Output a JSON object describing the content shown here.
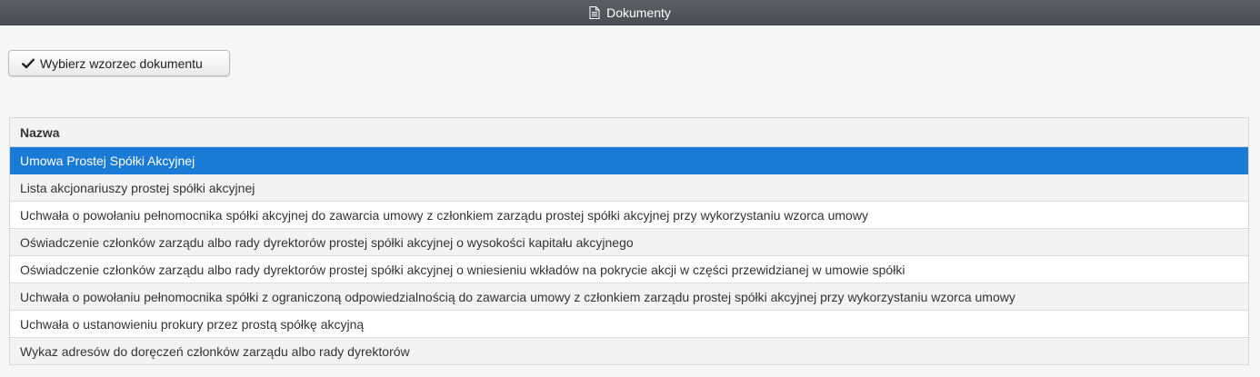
{
  "window": {
    "title": "Dokumenty",
    "icon": "document-icon"
  },
  "toolbar": {
    "select_template_label": "Wybierz wzorzec dokumentu",
    "select_template_icon": "check-icon"
  },
  "table": {
    "columns": [
      "Nazwa"
    ],
    "rows": [
      "Umowa Prostej Spółki Akcyjnej",
      "Lista akcjonariuszy prostej spółki akcyjnej",
      "Uchwała o powołaniu pełnomocnika spółki akcyjnej do zawarcia umowy z członkiem zarządu prostej spółki akcyjnej przy wykorzystaniu wzorca umowy",
      "Oświadczenie członków zarządu albo rady dyrektorów prostej spółki akcyjnej o wysokości kapitału akcyjnego",
      "Oświadczenie członków zarządu albo rady dyrektorów prostej spółki akcyjnej o wniesieniu wkładów na pokrycie akcji w części przewidzianej w umowie spółki",
      "Uchwała o powołaniu pełnomocnika spółki z ograniczoną odpowiedzialnością do zawarcia umowy z członkiem zarządu prostej spółki akcyjnej przy wykorzystaniu wzorca umowy",
      "Uchwała o ustanowieniu prokury przez prostą spółkę akcyjną",
      "Wykaz adresów do doręczeń członków zarządu albo rady dyrektorów"
    ],
    "selected_index": 0
  },
  "colors": {
    "titlebar": "#55575e",
    "selected_row": "#1a7bd6",
    "stripe": "#f3f3f3"
  }
}
